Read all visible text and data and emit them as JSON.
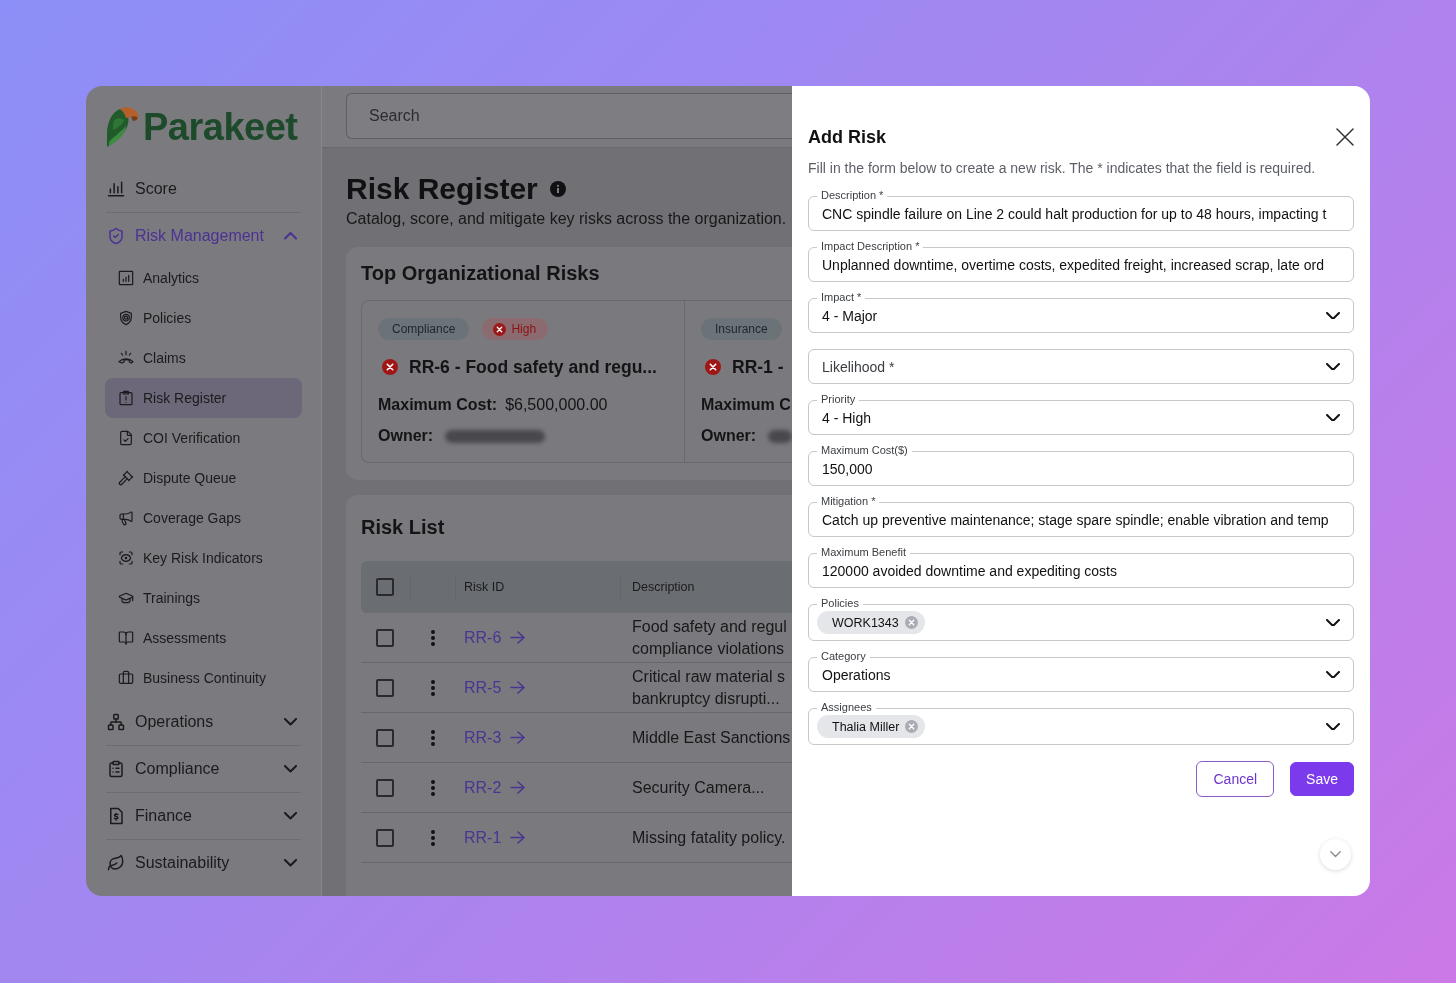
{
  "sidebar": {
    "logo": "Parakeet",
    "nav": [
      {
        "kind": "link",
        "label": "Score",
        "active": false
      },
      {
        "kind": "group",
        "label": "Risk Management",
        "active": true,
        "expanded": true,
        "children": [
          {
            "label": "Analytics",
            "selected": false
          },
          {
            "label": "Policies",
            "selected": false
          },
          {
            "label": "Claims",
            "selected": false
          },
          {
            "label": "Risk Register",
            "selected": true
          },
          {
            "label": "COI Verification",
            "selected": false
          },
          {
            "label": "Dispute Queue",
            "selected": false
          },
          {
            "label": "Coverage Gaps",
            "selected": false
          },
          {
            "label": "Key Risk Indicators",
            "selected": false
          },
          {
            "label": "Trainings",
            "selected": false
          },
          {
            "label": "Assessments",
            "selected": false
          },
          {
            "label": "Business Continuity",
            "selected": false
          }
        ]
      },
      {
        "kind": "group",
        "label": "Operations",
        "active": false,
        "expanded": false
      },
      {
        "kind": "group",
        "label": "Compliance",
        "active": false,
        "expanded": false
      },
      {
        "kind": "group",
        "label": "Finance",
        "active": false,
        "expanded": false
      },
      {
        "kind": "group",
        "label": "Sustainability",
        "active": false,
        "expanded": false
      }
    ]
  },
  "search": {
    "placeholder": "Search"
  },
  "header": {
    "title": "Risk Register",
    "subtitle": "Catalog, score, and mitigate key risks across the organization."
  },
  "top_risks": {
    "title": "Top Organizational Risks",
    "cards": [
      {
        "tags": [
          {
            "kind": "category",
            "label": "Compliance"
          },
          {
            "kind": "severity",
            "label": "High"
          }
        ],
        "title": "RR-6 - Food safety and regu...",
        "details": [
          {
            "label": "Maximum Cost:",
            "value": "$6,500,000.00"
          },
          {
            "label": "Owner:",
            "blurred": true
          }
        ]
      },
      {
        "tags": [
          {
            "kind": "category",
            "label": "Insurance"
          }
        ],
        "title": "RR-1 -",
        "details": [
          {
            "label": "Maximum C"
          },
          {
            "label": "Owner:",
            "blurred": true
          }
        ]
      }
    ]
  },
  "risk_list": {
    "title": "Risk List",
    "select_all": false,
    "columns": [
      "Risk ID",
      "Description"
    ],
    "rows": [
      {
        "checked": false,
        "id": "RR-6",
        "description": [
          "Food safety and regul",
          "compliance violations"
        ]
      },
      {
        "checked": false,
        "id": "RR-5",
        "description": [
          "Critical raw material s",
          "bankruptcy disrupti..."
        ]
      },
      {
        "checked": false,
        "id": "RR-3",
        "description": [
          "Middle East Sanctions"
        ]
      },
      {
        "checked": false,
        "id": "RR-2",
        "description": [
          "Security Camera..."
        ]
      },
      {
        "checked": false,
        "id": "RR-1",
        "description": [
          "Missing fatality policy."
        ]
      }
    ]
  },
  "drawer": {
    "title": "Add Risk",
    "subtitle": "Fill in the form below to create a new risk. The * indicates that the field is required.",
    "fields": [
      {
        "kind": "text",
        "label": "Description *",
        "value": "CNC spindle failure on Line 2 could halt production for up to 48 hours, impacting t"
      },
      {
        "kind": "text",
        "label": "Impact Description *",
        "value": "Unplanned downtime, overtime costs, expedited freight, increased scrap, late ord"
      },
      {
        "kind": "select",
        "label": "Impact *",
        "value": "4 - Major"
      },
      {
        "kind": "select",
        "placeholder": "Likelihood *"
      },
      {
        "kind": "select",
        "label": "Priority",
        "value": "4 - High"
      },
      {
        "kind": "text",
        "label": "Maximum Cost($)",
        "value": "150,000"
      },
      {
        "kind": "text",
        "label": "Mitigation *",
        "value": "Catch up preventive maintenance; stage spare spindle; enable vibration and temp"
      },
      {
        "kind": "text",
        "label": "Maximum Benefit",
        "value": "120000 avoided downtime and expediting costs"
      },
      {
        "kind": "chips",
        "label": "Policies",
        "chips": [
          "WORK1343"
        ]
      },
      {
        "kind": "select",
        "label": "Category",
        "value": "Operations"
      },
      {
        "kind": "chips",
        "label": "Assignees",
        "chips": [
          "Thalia Miller"
        ]
      }
    ],
    "buttons": [
      {
        "kind": "secondary",
        "label": "Cancel"
      },
      {
        "kind": "primary",
        "label": "Save"
      }
    ]
  }
}
